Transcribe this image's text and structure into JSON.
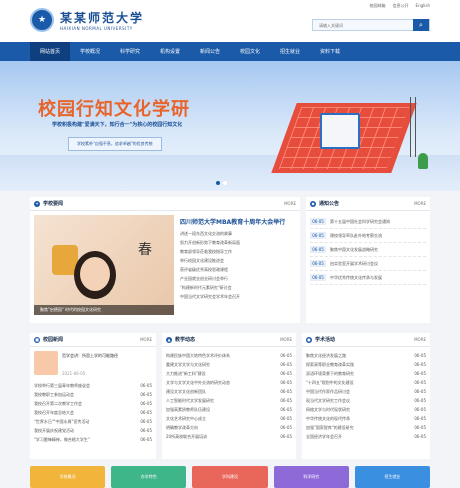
{
  "header": {
    "logo_cn": "某某师范大学",
    "logo_en": "HAIXIAN NORMAL UNIVERSITY",
    "top_links": [
      "校园邮箱",
      "信息公开",
      "English"
    ],
    "search_placeholder": "请输入关键词"
  },
  "nav": [
    "网站首页",
    "学校概况",
    "科学研究",
    "机构设置",
    "新闻公告",
    "校园文化",
    "招生就业",
    "资料下载"
  ],
  "banner": {
    "title": "校园行知文化学研",
    "subtitle": "学校积极构建\"爱满天下，知行合一\"为核心的校园行知文化",
    "slogan": "学校素朴\"自强不息，追求卓越\"的优良传统"
  },
  "school_news": {
    "title": "学校要闻",
    "more": "MORE",
    "headline": "四川师范大学MBA教育十周年大会举行",
    "photo_caption": "聚焦\"启德园\" 时代的校园文化研究",
    "items": [
      "讲述一段东西文化交流的故事",
      "努力开创新形势下教育改革新局面",
      "教育部领导莅临我校指导工作",
      "举行校园文化建设推进会",
      "获评省级优秀高校思政课程",
      "产业园就业创业研讨会举行",
      "\"构建新时代元素研究\"研讨会",
      "中国当代文学研究会学术年会召开"
    ]
  },
  "notices": {
    "title": "通知公告",
    "more": "MORE",
    "items": [
      {
        "date": "06-05",
        "text": "第十五届中国社会科学研究会通知"
      },
      {
        "date": "06-05",
        "text": "建校领导率队赴外地考察交流"
      },
      {
        "date": "06-05",
        "text": "聚焦中国文化发展战略研究"
      },
      {
        "date": "06-05",
        "text": "由实验室开展学术研讨会议"
      },
      {
        "date": "06-05",
        "text": "中华优秀传统文化传承与发展"
      }
    ]
  },
  "campus_news": {
    "title": "校园新闻",
    "more": "MORE",
    "feature_title": "哲学会讲：所思上学的可能路径",
    "feature_date": "2021-06-05",
    "items": [
      {
        "text": "学校举行第三届青年教师座谈会",
        "date": "06-05"
      },
      {
        "text": "我校教职工参加运动会",
        "date": "06-05"
      },
      {
        "text": "我校召开第二次教学工作会",
        "date": "06-05"
      },
      {
        "text": "我校召开年度总结大会",
        "date": "06-05"
      },
      {
        "text": "\"世界水日\"\"中国水周\"宣传活动",
        "date": "06-05"
      },
      {
        "text": "我校开展庆祝建党活动",
        "date": "06-05"
      },
      {
        "text": "\"学习雷锋精神，做合格大学生\"",
        "date": "06-05"
      }
    ]
  },
  "teaching": {
    "title": "教学动态",
    "more": "MORE",
    "items": [
      {
        "text": "构建民族中国大地特色学术评价体系",
        "date": "06-05"
      },
      {
        "text": "重建文学文学与文化研究",
        "date": "06-05"
      },
      {
        "text": "大力推进\"新工科\"建设",
        "date": "06-05"
      },
      {
        "text": "文学与文学文化中外交流的研究动态",
        "date": "06-05"
      },
      {
        "text": "建设文学文化创新团队",
        "date": "06-05"
      },
      {
        "text": "人工智能时代文学发展研究",
        "date": "06-05"
      },
      {
        "text": "加强高素质教师队伍建设",
        "date": "06-05"
      },
      {
        "text": "文化艺术研究中心成立",
        "date": "06-05"
      },
      {
        "text": "明确教学改革方向",
        "date": "06-05"
      },
      {
        "text": "20所高校联合开展培训",
        "date": "06-05"
      }
    ]
  },
  "academic": {
    "title": "学术活动",
    "more": "MORE",
    "items": [
      {
        "text": "聚焦文化经济发展之路",
        "date": "06-05"
      },
      {
        "text": "探索高等职业教育改革实践",
        "date": "06-05"
      },
      {
        "text": "双语环境背景下的教育研究",
        "date": "06-05"
      },
      {
        "text": "\"十四五\"规划中的文化建设",
        "date": "06-05"
      },
      {
        "text": "中国当代作家作品研讨会",
        "date": "06-05"
      },
      {
        "text": "现当代文学研究工作会议",
        "date": "06-05"
      },
      {
        "text": "网络文学与时代现状研究",
        "date": "06-05"
      },
      {
        "text": "中华传统文化的现代传承",
        "date": "06-05"
      },
      {
        "text": "加强\"国家智库\"的建设研究",
        "date": "06-05"
      },
      {
        "text": "全国经济学年会召开",
        "date": "06-05"
      }
    ]
  },
  "cards": [
    {
      "label": "学校概况",
      "color": "#f2b53c"
    },
    {
      "label": "办学特色",
      "color": "#3fb58a"
    },
    {
      "label": "学科建设",
      "color": "#e9665b"
    },
    {
      "label": "科学研究",
      "color": "#8e6ad8"
    },
    {
      "label": "招生就业",
      "color": "#3a8fe0"
    }
  ],
  "colors": {
    "primary": "#1a5aa8",
    "nav_active": "#0f3f7e",
    "banner_title": "#e8642b"
  }
}
